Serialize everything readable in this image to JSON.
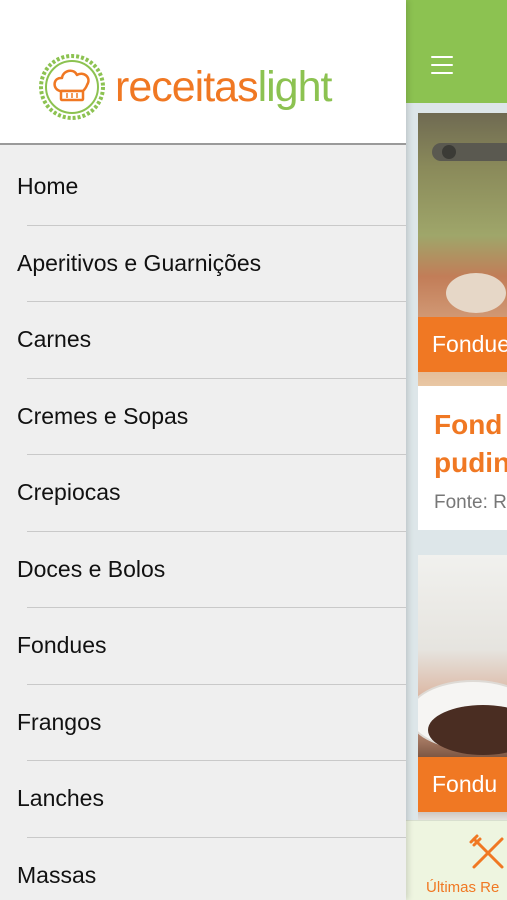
{
  "drawer": {
    "logo": {
      "part1": "receitas",
      "part2": "light"
    },
    "items": [
      {
        "label": "Home"
      },
      {
        "label": "Aperitivos e Guarnições"
      },
      {
        "label": "Carnes"
      },
      {
        "label": "Cremes e Sopas"
      },
      {
        "label": "Crepiocas"
      },
      {
        "label": "Doces e Bolos"
      },
      {
        "label": "Fondues"
      },
      {
        "label": "Frangos"
      },
      {
        "label": "Lanches"
      },
      {
        "label": "Massas"
      }
    ]
  },
  "app": {
    "header": {
      "menu_icon": "hamburger-icon"
    },
    "cards": [
      {
        "category": "Fondue",
        "title_line1": "Fond",
        "title_line2": "pudin",
        "source": "Fonte: R"
      },
      {
        "category": "Fondu"
      }
    ],
    "bottom_tab": {
      "icon": "fork-knife-icon",
      "label": "Últimas Re"
    }
  },
  "colors": {
    "orange": "#f07823",
    "green": "#8cc251",
    "drawer_bg": "#efefef"
  }
}
